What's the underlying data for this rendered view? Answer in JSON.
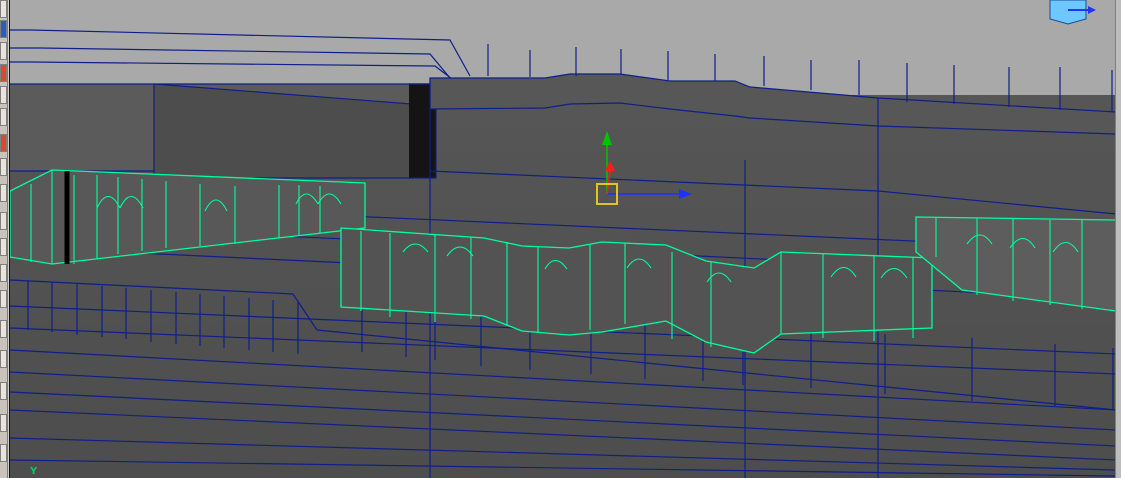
{
  "viewport": {
    "axis_label": "Y"
  },
  "colors": {
    "background": "#a8a8a8",
    "wireframe": "#0f1f8a",
    "selection": "#00ff9c",
    "manipulator_x": "#1e31ff",
    "manipulator_y": "#00c300",
    "manipulator_z": "#ff1b1b",
    "manipulator_center": "#e2c421"
  },
  "icons": {
    "view_cube": "view-cube-icon"
  }
}
